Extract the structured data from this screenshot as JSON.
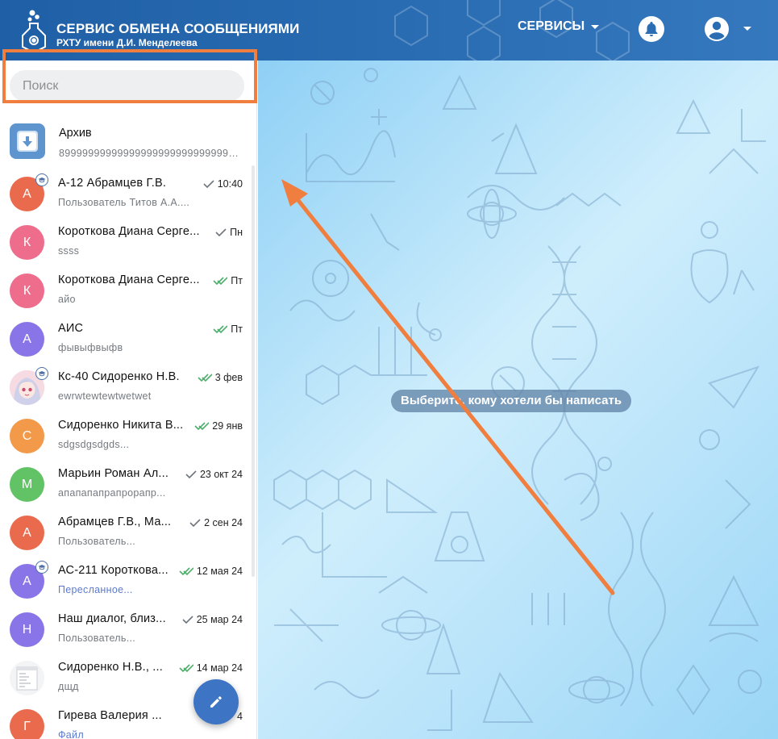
{
  "header": {
    "title": "СЕРВИС ОБМЕНА СООБЩЕНИЯМИ",
    "subtitle": "РХТУ имени Д.И. Менделеева",
    "services_label": "СЕРВИСЫ",
    "logo_icon": "flask-logo-icon",
    "bell_icon": "bell-icon",
    "account_icon": "account-circle-icon"
  },
  "sidebar": {
    "search_placeholder": "Поиск",
    "archive": {
      "name": "Архив",
      "preview": "8999999999999999999999999999999999"
    },
    "chats": [
      {
        "initial": "А",
        "color": "#ea6a4d",
        "name": "А-12 Абрамцев Г.В.",
        "preview": "Пользователь Титов А.А....",
        "time": "10:40",
        "check": "single",
        "group": true,
        "accent": false
      },
      {
        "initial": "К",
        "color": "#ee6c8c",
        "name": "Короткова Диана Серге...",
        "preview": "ssss",
        "time": "Пн",
        "check": "single",
        "group": false,
        "accent": false
      },
      {
        "initial": "К",
        "color": "#ee6c8c",
        "name": "Короткова Диана Серге...",
        "preview": "айо",
        "time": "Пт",
        "check": "double",
        "group": false,
        "accent": false
      },
      {
        "initial": "А",
        "color": "#8a75e8",
        "name": "АИС",
        "preview": "фывыфвыфв",
        "time": "Пт",
        "check": "double",
        "group": false,
        "accent": false
      },
      {
        "initial": "",
        "color": "#f3c7d3",
        "name": "Кс-40 Сидоренко Н.В.",
        "preview": "ewrwtewtewtwetwet",
        "time": "3 фев",
        "check": "double",
        "group": true,
        "accent": false,
        "anime": true
      },
      {
        "initial": "С",
        "color": "#f39a4a",
        "name": "Сидоренко Никита В...",
        "preview": "sdgsdgsdgds...",
        "time": "29 янв",
        "check": "double",
        "group": false,
        "accent": false
      },
      {
        "initial": "М",
        "color": "#62c266",
        "name": "Марьин Роман Ал...",
        "preview": "апапапапрапрорапр...",
        "time": "23 окт 24",
        "check": "single",
        "group": false,
        "accent": false
      },
      {
        "initial": "А",
        "color": "#ea6a4d",
        "name": "Абрамцев Г.В., Ма...",
        "preview": "Пользователь...",
        "time": "2 сен 24",
        "check": "single",
        "group": false,
        "accent": false
      },
      {
        "initial": "А",
        "color": "#8a75e8",
        "name": "АС-211 Короткова...",
        "preview": "Пересланное...",
        "time": "12 мая 24",
        "check": "double",
        "group": true,
        "accent": true
      },
      {
        "initial": "Н",
        "color": "#8a75e8",
        "name": "Наш диалог, близ...",
        "preview": "Пользователь...",
        "time": "25 мар 24",
        "check": "single",
        "group": false,
        "accent": false
      },
      {
        "initial": "",
        "color": "#f2f2f2",
        "name": "Сидоренко Н.В., ...",
        "preview": "дщд",
        "time": "14 мар 24",
        "check": "double",
        "group": false,
        "accent": false,
        "doc": true
      },
      {
        "initial": "Г",
        "color": "#ea6a4d",
        "name": "Гирева Валерия ...",
        "preview": "Файл",
        "time": "4",
        "check": "double",
        "group": false,
        "accent": true
      }
    ],
    "compose_icon": "pencil-icon"
  },
  "main": {
    "placeholder": "Выберите, кому хотели бы написать"
  },
  "colors": {
    "header": "#2a6db3",
    "highlight_box": "#f07e3e",
    "arrow": "#f07e3e",
    "fab": "#3d74c4",
    "check": "#4caf6a"
  }
}
